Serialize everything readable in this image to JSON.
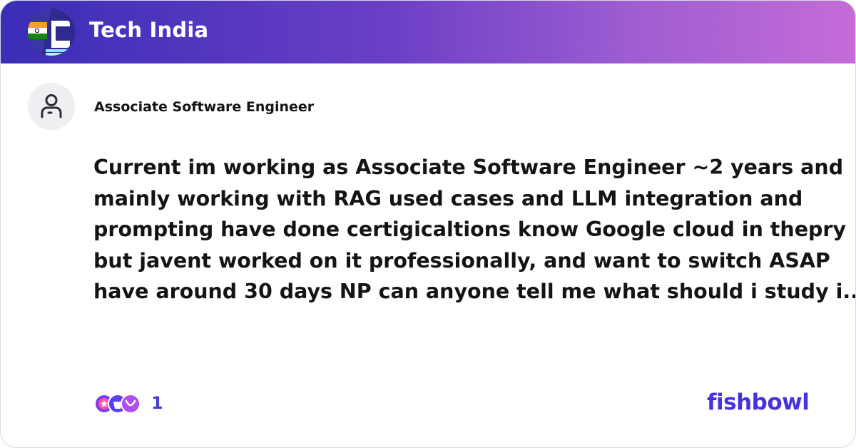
{
  "header": {
    "bowl_name": "Tech India",
    "logo_icon": "tech-india-bowl-logo"
  },
  "post": {
    "author_title": "Associate Software Engineer",
    "body_lines": [
      "Current im working as Associate Software Engineer  ~2 years and",
      "mainly working with RAG used cases and LLM integration and",
      "prompting have done certigicaltions know Google cloud in thepry",
      "but javent worked on it professionally, and want to switch ASAP",
      "have around 30 days NP can anyone tell me what should i study i..."
    ]
  },
  "footer": {
    "reaction_count": "1",
    "brand": "fishbowl"
  },
  "colors": {
    "header_gradient_start": "#3a2db6",
    "header_gradient_end": "#c56bd8",
    "brand": "#4431e0",
    "text": "#141414"
  }
}
